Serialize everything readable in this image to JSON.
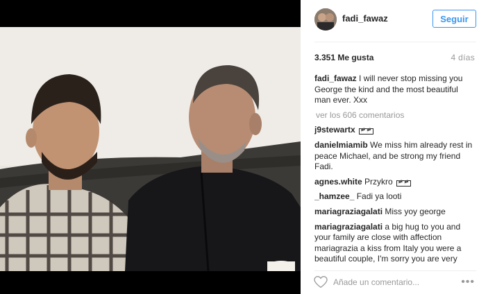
{
  "header": {
    "username": "fadi_fawaz",
    "follow_label": "Seguir"
  },
  "post": {
    "likes": "3.351 Me gusta",
    "age": "4 días"
  },
  "caption": {
    "user": "fadi_fawaz",
    "text": "I will never stop missing you George the kind and the most beautiful man ever. Xxx"
  },
  "view_more": "ver los 606 comentarios",
  "comments": [
    {
      "user": "j9stewartx",
      "text": "",
      "glyph": "🏴🏴"
    },
    {
      "user": "danielmiamib",
      "text": "We miss him already rest in peace Michael, and be strong my friend Fadi.",
      "glyph": ""
    },
    {
      "user": "agnes.white",
      "text": "Przykro",
      "glyph": "🏴🏴"
    },
    {
      "user": "_hamzee_",
      "text": "Fadi ya looti",
      "glyph": ""
    },
    {
      "user": "mariagraziagalati",
      "text": "Miss yoy george",
      "glyph": ""
    },
    {
      "user": "mariagraziagalati",
      "text": "a big hug to you and your family are close with affection mariagrazia a kiss from Italy you were a beautiful couple, I'm sorry you are very near misses. much at all george",
      "glyph": ""
    }
  ],
  "footer": {
    "add_comment_placeholder": "Añade un comentario...",
    "more_icon": "ellipsis-icon",
    "like_icon": "heart-icon"
  },
  "colors": {
    "accent": "#3897f0",
    "muted": "#999999",
    "text": "#262626"
  }
}
